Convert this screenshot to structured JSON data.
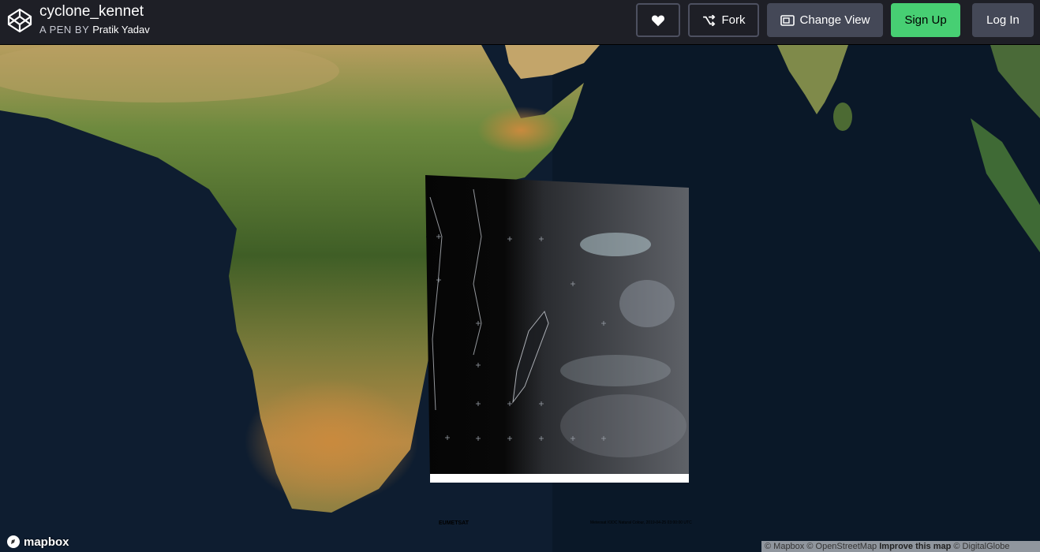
{
  "header": {
    "pen_title": "cyclone_kennet",
    "byline_prefix": "A PEN BY",
    "author": "Pratik Yadav",
    "fork_label": "Fork",
    "change_view_label": "Change View",
    "signup_label": "Sign Up",
    "login_label": "Log In"
  },
  "icons": {
    "logo": "codepen-logo-icon",
    "heart": "heart-icon",
    "fork": "fork-icon",
    "view": "change-view-icon",
    "mapbox": "mapbox-logo-icon"
  },
  "colors": {
    "topbar": "#1e1f26",
    "signup": "#47cf73",
    "button": "#444857"
  },
  "map": {
    "logo_label": "mapbox",
    "attribution": {
      "mapbox": "© Mapbox",
      "osm": "© OpenStreetMap",
      "improve": "Improve this map",
      "digitalglobe": "© DigitalGlobe"
    },
    "overlay": {
      "brand": "EUMETSAT",
      "caption": "Meteosat IODC Natural Colour, 2019-04-25 03:00:00 UTC"
    }
  }
}
